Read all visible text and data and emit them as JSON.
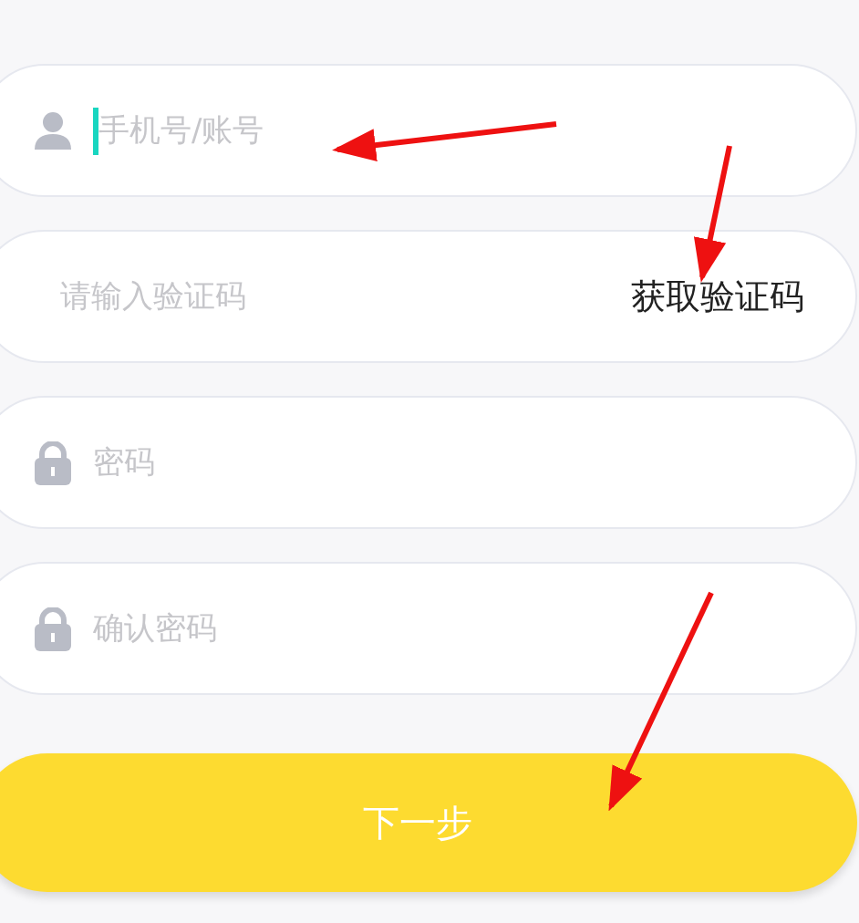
{
  "fields": [
    {
      "kind": "user",
      "placeholder": "手机号/账号",
      "focused": true
    },
    {
      "kind": "plain",
      "placeholder": "请输入验证码",
      "focused": false,
      "action": "获取验证码"
    },
    {
      "kind": "lock",
      "placeholder": "密码",
      "focused": false
    },
    {
      "kind": "lock",
      "placeholder": "确认密码",
      "focused": false
    }
  ],
  "button": {
    "label": "下一步"
  },
  "annotations": [
    {
      "kind": "arrow"
    },
    {
      "kind": "arrow"
    },
    {
      "kind": "arrow"
    }
  ]
}
